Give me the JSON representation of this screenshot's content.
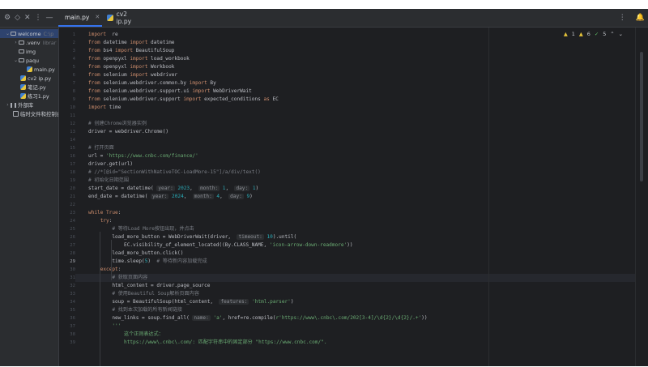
{
  "toolbar": {
    "icons": [
      "settings-icon",
      "expand-icon",
      "collapse-icon",
      "more-icon",
      "minimize-icon"
    ]
  },
  "tabs": [
    {
      "label": "main.py",
      "active": true
    },
    {
      "label": "cv2 ip.py",
      "active": false
    }
  ],
  "right_icons": [
    "more-vertical-icon",
    "notifications-icon"
  ],
  "project_tree": [
    {
      "label": "welcome",
      "suffix": "C:\\p",
      "type": "folder",
      "indent": 0,
      "expanded": true,
      "selected": true
    },
    {
      "label": ".venv",
      "suffix": "librar",
      "type": "folder",
      "indent": 1,
      "expanded": false
    },
    {
      "label": "img",
      "type": "folder",
      "indent": 1
    },
    {
      "label": "paqu",
      "type": "folder",
      "indent": 1,
      "expanded": true
    },
    {
      "label": "main.py",
      "type": "python",
      "indent": 2
    },
    {
      "label": "cv2 ip.py",
      "type": "python",
      "indent": 1
    },
    {
      "label": "笔记.py",
      "type": "python",
      "indent": 1
    },
    {
      "label": "练习1.py",
      "type": "python",
      "indent": 1
    },
    {
      "label": "外部库",
      "type": "library",
      "indent": 0,
      "expanded": false
    },
    {
      "label": "临时文件和控制台",
      "type": "scratch",
      "indent": 0
    }
  ],
  "inspections": {
    "warnings": "1",
    "weak": "6",
    "ok": "5"
  },
  "current_line": "29",
  "lines": [
    {
      "n": "1",
      "s": [
        [
          "kw",
          "import"
        ],
        [
          "",
          "  re"
        ]
      ]
    },
    {
      "n": "2",
      "s": [
        [
          "kw",
          "from"
        ],
        [
          "",
          " datetime "
        ],
        [
          "kw",
          "import"
        ],
        [
          "",
          " datetime"
        ]
      ]
    },
    {
      "n": "3",
      "s": [
        [
          "kw",
          "from"
        ],
        [
          "",
          " bs4 "
        ],
        [
          "kw",
          "import"
        ],
        [
          "",
          " BeautifulSoup"
        ]
      ]
    },
    {
      "n": "4",
      "s": [
        [
          "kw",
          "from"
        ],
        [
          "",
          " openpyxl "
        ],
        [
          "kw",
          "import"
        ],
        [
          "",
          " load_workbook"
        ]
      ]
    },
    {
      "n": "5",
      "s": [
        [
          "kw",
          "from"
        ],
        [
          "",
          " openpyxl "
        ],
        [
          "kw",
          "import"
        ],
        [
          "",
          " Workbook"
        ]
      ]
    },
    {
      "n": "6",
      "s": [
        [
          "kw",
          "from"
        ],
        [
          "",
          " selenium "
        ],
        [
          "kw",
          "import"
        ],
        [
          "",
          " webdriver"
        ]
      ]
    },
    {
      "n": "7",
      "s": [
        [
          "kw",
          "from"
        ],
        [
          "",
          " selenium.webdriver.common.by "
        ],
        [
          "kw",
          "import"
        ],
        [
          "",
          " By"
        ]
      ]
    },
    {
      "n": "8",
      "s": [
        [
          "kw",
          "from"
        ],
        [
          "",
          " selenium.webdriver.support.ui "
        ],
        [
          "kw",
          "import"
        ],
        [
          "",
          " WebDriverWait"
        ]
      ]
    },
    {
      "n": "9",
      "s": [
        [
          "kw",
          "from"
        ],
        [
          "",
          " selenium.webdriver.support "
        ],
        [
          "kw",
          "import"
        ],
        [
          "",
          " expected_conditions "
        ],
        [
          "kw",
          "as"
        ],
        [
          "",
          " EC"
        ]
      ]
    },
    {
      "n": "10",
      "s": [
        [
          "kw",
          "import"
        ],
        [
          "",
          " time"
        ]
      ]
    },
    {
      "n": "11",
      "s": []
    },
    {
      "n": "12",
      "s": [
        [
          "cm",
          "# 创建Chrome浏览器实例"
        ]
      ]
    },
    {
      "n": "13",
      "s": [
        [
          "",
          "driver = webdriver.Chrome()"
        ]
      ]
    },
    {
      "n": "14",
      "s": []
    },
    {
      "n": "15",
      "s": [
        [
          "cm",
          "# 打开页面"
        ]
      ]
    },
    {
      "n": "16",
      "s": [
        [
          "",
          "url = "
        ],
        [
          "st",
          "'https://www.cnbc.com/finance/'"
        ]
      ]
    },
    {
      "n": "17",
      "s": [
        [
          "",
          "driver.get(url)"
        ]
      ]
    },
    {
      "n": "18",
      "s": [
        [
          "cm",
          "# //*[@id=\"SectionWithNativeTOC-LoadMore-15\"]/a/div/text()"
        ]
      ]
    },
    {
      "n": "19",
      "s": [
        [
          "cm",
          "# 初始化日期范围"
        ]
      ]
    },
    {
      "n": "20",
      "s": [
        [
          "",
          "start_date = datetime( "
        ],
        [
          "hn",
          "year:"
        ],
        [
          "nm",
          " 2023"
        ],
        [
          "",
          ",  "
        ],
        [
          "hn",
          "month:"
        ],
        [
          "nm",
          " 1"
        ],
        [
          "",
          ",  "
        ],
        [
          "hn",
          "day:"
        ],
        [
          "nm",
          " 1"
        ],
        [
          "",
          ")"
        ]
      ]
    },
    {
      "n": "21",
      "s": [
        [
          "",
          "end_date = datetime( "
        ],
        [
          "hn",
          "year:"
        ],
        [
          "nm",
          " 2024"
        ],
        [
          "",
          ",  "
        ],
        [
          "hn",
          "month:"
        ],
        [
          "nm",
          " 4"
        ],
        [
          "",
          ",  "
        ],
        [
          "hn",
          "day:"
        ],
        [
          "nm",
          " 9"
        ],
        [
          "",
          ")"
        ]
      ]
    },
    {
      "n": "22",
      "s": []
    },
    {
      "n": "23",
      "s": [
        [
          "kw",
          "while True"
        ],
        [
          "",
          ":"
        ]
      ]
    },
    {
      "n": "24",
      "s": [
        [
          "",
          "    "
        ],
        [
          "kw",
          "try"
        ],
        [
          "",
          ":"
        ]
      ]
    },
    {
      "n": "25",
      "s": [
        [
          "",
          "        "
        ],
        [
          "cm",
          "# 等待Load More按钮出现，并点击"
        ]
      ]
    },
    {
      "n": "26",
      "s": [
        [
          "",
          "        load_more_button = WebDriverWait(driver,  "
        ],
        [
          "hn",
          "timeout:"
        ],
        [
          "nm",
          " 10"
        ],
        [
          "",
          ").until("
        ]
      ]
    },
    {
      "n": "27",
      "s": [
        [
          "",
          "            EC.visibility_of_element_located((By.CLASS_NAME, "
        ],
        [
          "st",
          "'icon-arrow-down-readmore'"
        ],
        [
          "",
          "))"
        ]
      ]
    },
    {
      "n": "28",
      "s": [
        [
          "",
          "        load_more_button.click()"
        ]
      ]
    },
    {
      "n": "29",
      "s": [
        [
          "",
          "        time.sleep("
        ],
        [
          "nm",
          "5"
        ],
        [
          "",
          ")  "
        ],
        [
          "cm",
          "# 等待新内容加载完成"
        ]
      ]
    },
    {
      "n": "30",
      "s": [
        [
          "",
          "    "
        ],
        [
          "kw",
          "except"
        ],
        [
          "",
          ":"
        ]
      ]
    },
    {
      "n": "31",
      "s": [
        [
          "",
          "        "
        ],
        [
          "cm",
          "# 获取页面内容"
        ]
      ]
    },
    {
      "n": "32",
      "s": [
        [
          "",
          "        html_content = driver.page_source"
        ]
      ]
    },
    {
      "n": "33",
      "s": [
        [
          "",
          "        "
        ],
        [
          "cm",
          "# 使用Beautiful Soup解析页面内容"
        ]
      ]
    },
    {
      "n": "34",
      "s": [
        [
          "",
          "        soup = BeautifulSoup(html_content,  "
        ],
        [
          "hn",
          "features:"
        ],
        [
          "st",
          " 'html.parser'"
        ],
        [
          "",
          ")"
        ]
      ]
    },
    {
      "n": "35",
      "s": [
        [
          "",
          "        "
        ],
        [
          "cm",
          "# 找到本次加载的所有新闻链接"
        ]
      ]
    },
    {
      "n": "36",
      "s": [
        [
          "",
          "        new_links = soup.find_all( "
        ],
        [
          "hn",
          "name:"
        ],
        [
          "st",
          " 'a'"
        ],
        [
          "",
          ", href=re.compile("
        ],
        [
          "st",
          "r'https://www\\.cnbc\\.com/202[3-4]/\\d{2}/\\d{2}/.+'"
        ],
        [
          "",
          "))"
        ]
      ]
    },
    {
      "n": "37",
      "s": [
        [
          "",
          "        "
        ],
        [
          "st",
          "'''"
        ]
      ]
    },
    {
      "n": "38",
      "s": [
        [
          "",
          "            "
        ],
        [
          "st",
          "这个正则表达式："
        ]
      ]
    },
    {
      "n": "39",
      "s": [
        [
          "",
          "            "
        ],
        [
          "st",
          "https://www\\.cnbc\\.com/: 匹配字符串中的固定部分 \"https://www.cnbc.com/\"."
        ]
      ]
    }
  ]
}
